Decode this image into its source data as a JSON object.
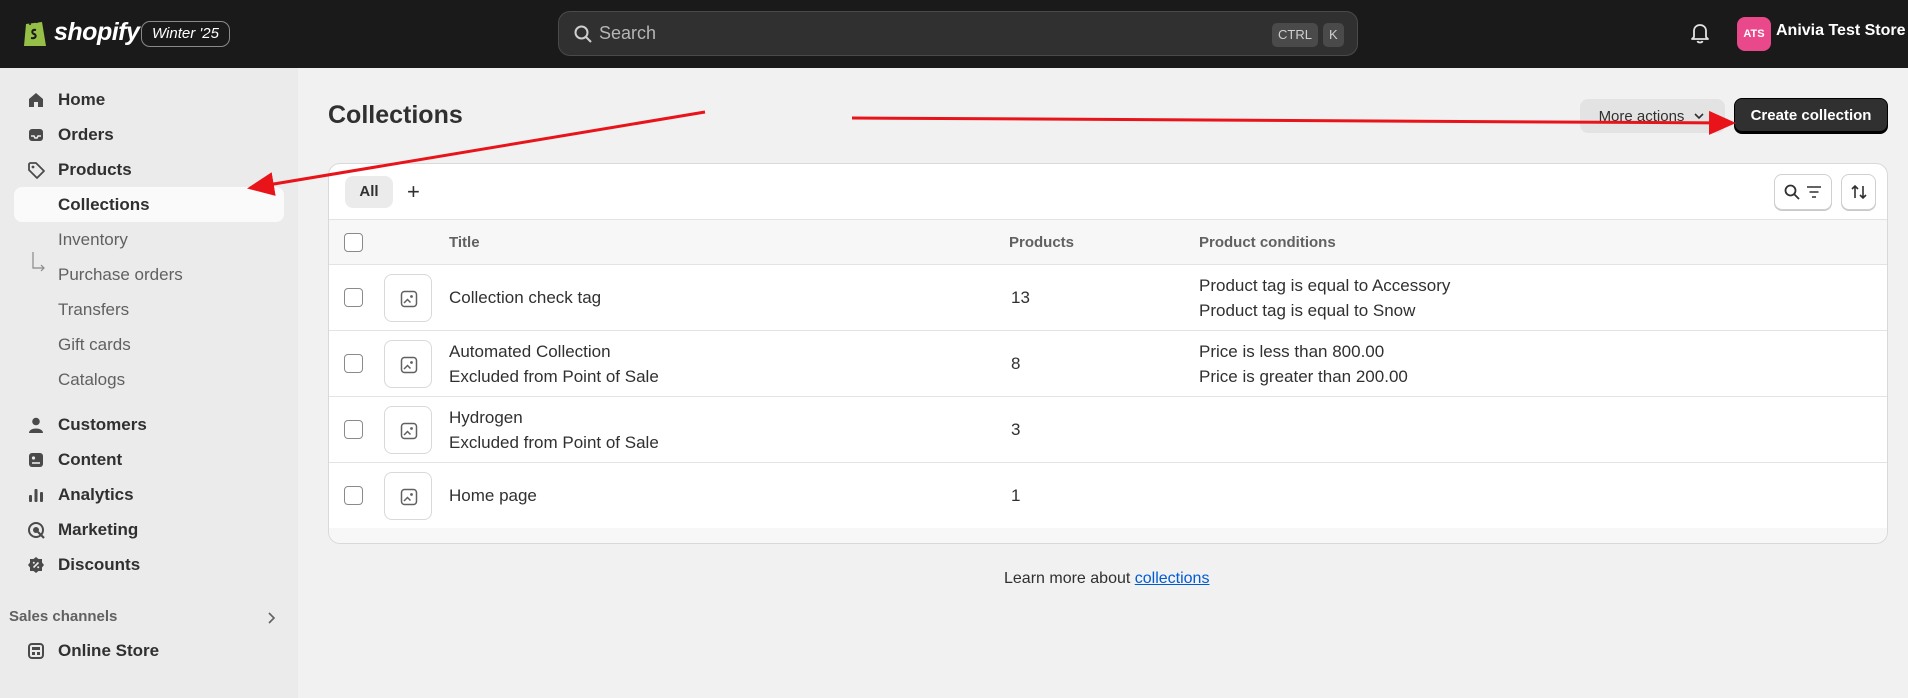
{
  "topbar": {
    "brand": "shopify",
    "edition": "Winter '25",
    "search_placeholder": "Search",
    "shortcut_ctrl": "CTRL",
    "shortcut_key": "K",
    "store_initials": "ATS",
    "store_name": "Anivia Test Store"
  },
  "sidebar": {
    "items": [
      {
        "label": "Home"
      },
      {
        "label": "Orders"
      },
      {
        "label": "Products"
      },
      {
        "label": "Collections"
      },
      {
        "label": "Inventory"
      },
      {
        "label": "Purchase orders"
      },
      {
        "label": "Transfers"
      },
      {
        "label": "Gift cards"
      },
      {
        "label": "Catalogs"
      },
      {
        "label": "Customers"
      },
      {
        "label": "Content"
      },
      {
        "label": "Analytics"
      },
      {
        "label": "Marketing"
      },
      {
        "label": "Discounts"
      }
    ],
    "sales_channels_label": "Sales channels",
    "online_store_label": "Online Store"
  },
  "page": {
    "title": "Collections",
    "more_actions_label": "More actions",
    "create_label": "Create collection",
    "tab_all": "All",
    "tab_add": "+"
  },
  "table": {
    "headers": {
      "title": "Title",
      "products": "Products",
      "conditions": "Product conditions"
    },
    "rows": [
      {
        "title": "Collection check tag",
        "subtitle": "",
        "products": "13",
        "cond1": "Product tag is equal to Accessory",
        "cond2": "Product tag is equal to Snow"
      },
      {
        "title": "Automated Collection",
        "subtitle": "Excluded from Point of Sale",
        "products": "8",
        "cond1": "Price is less than 800.00",
        "cond2": "Price is greater than 200.00"
      },
      {
        "title": "Hydrogen",
        "subtitle": "Excluded from Point of Sale",
        "products": "3",
        "cond1": "",
        "cond2": ""
      },
      {
        "title": "Home page",
        "subtitle": "",
        "products": "1",
        "cond1": "",
        "cond2": ""
      }
    ]
  },
  "footer": {
    "learn_prefix": "Learn more about ",
    "learn_link": "collections"
  },
  "colors": {
    "topbar": "#1a1a1a",
    "primary_button": "#303030",
    "avatar": "#e9498a",
    "link": "#005bd3",
    "annotation_arrow": "#e8141a"
  }
}
